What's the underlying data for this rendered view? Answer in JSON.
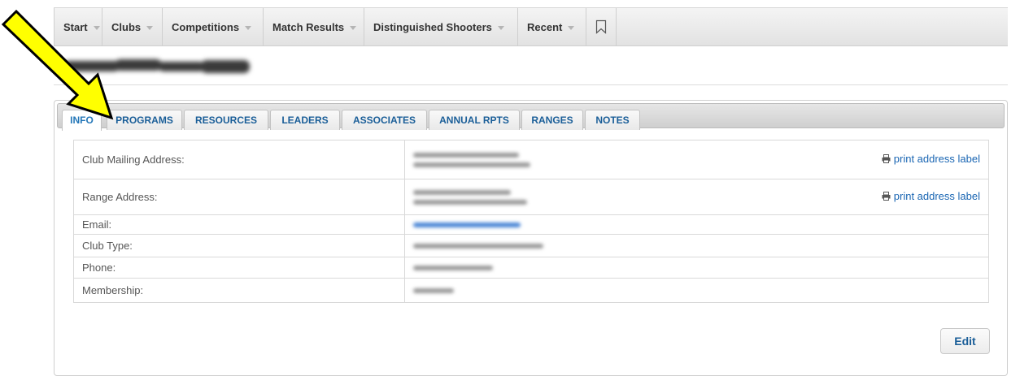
{
  "nav": {
    "items": [
      {
        "label": "Start"
      },
      {
        "label": "Clubs"
      },
      {
        "label": "Competitions"
      },
      {
        "label": "Match Results"
      },
      {
        "label": "Distinguished Shooters"
      },
      {
        "label": "Recent"
      }
    ],
    "bookmark_icon": "bookmark-icon"
  },
  "tabs": [
    {
      "label": "INFO",
      "active": true
    },
    {
      "label": "PROGRAMS"
    },
    {
      "label": "RESOURCES"
    },
    {
      "label": "LEADERS"
    },
    {
      "label": "ASSOCIATES"
    },
    {
      "label": "ANNUAL RPTS"
    },
    {
      "label": "RANGES"
    },
    {
      "label": "NOTES"
    }
  ],
  "info": {
    "rows": [
      {
        "label": "Club Mailing Address:",
        "action": "print address label"
      },
      {
        "label": "Range Address:",
        "action": "print address label"
      },
      {
        "label": "Email:"
      },
      {
        "label": "Club Type:"
      },
      {
        "label": "Phone:"
      },
      {
        "label": "Membership:"
      }
    ],
    "print_icon": "printer-icon"
  },
  "edit_label": "Edit",
  "colors": {
    "tab_text": "#1a5e98",
    "link": "#1a66b3",
    "arrow_fill": "#ffff00"
  }
}
